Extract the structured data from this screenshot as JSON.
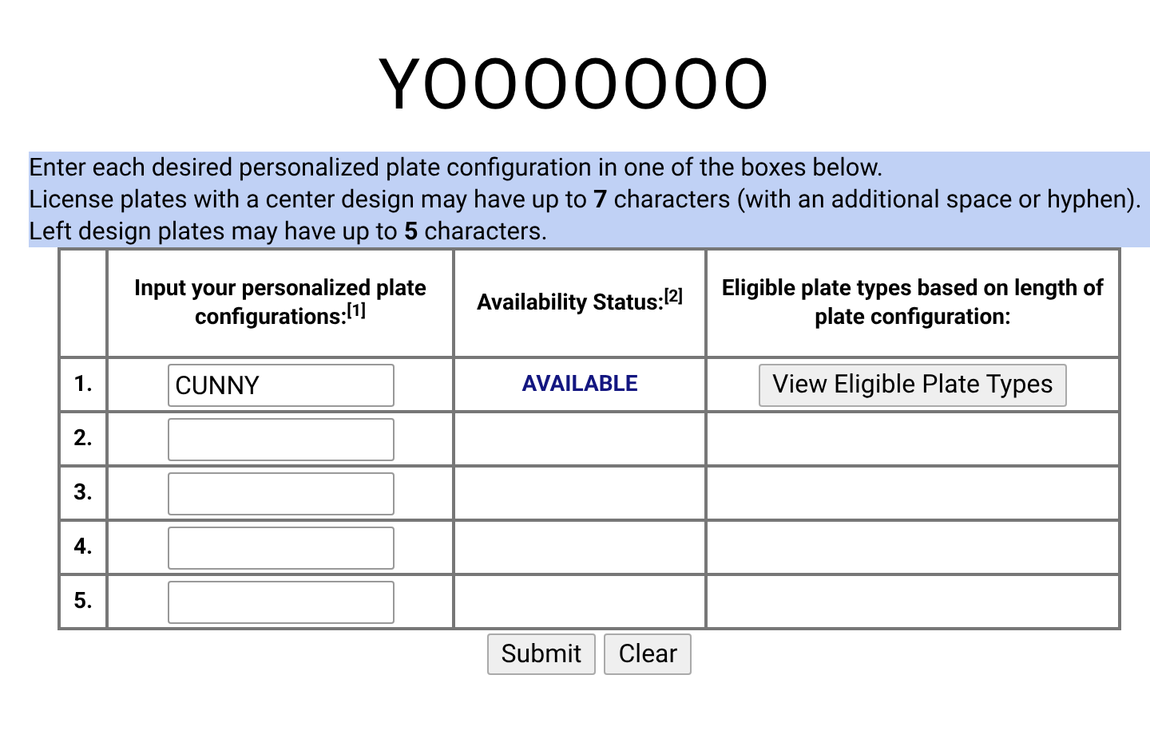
{
  "heading": "YOOOOOOO",
  "instructions": {
    "selected": true,
    "lines": [
      "Enter each desired personalized plate configuration in one of the boxes below.",
      "License plates with a center design may have up to **7** characters (with an additional space or hyphen). Left design plates may have up to **5** characters."
    ]
  },
  "table": {
    "columns": [
      "Input your personalized plate configurations:$^{[1]}$",
      "Availability Status:$^{[2]}$",
      "Eligible plate types based on length of plate configuration:"
    ],
    "rows": [
      {
        "number": "1.",
        "value": "CUNNY",
        "status": "AVAILABLE",
        "action": "View Eligible Plate Types"
      },
      {
        "number": "2."
      },
      {
        "number": "3."
      },
      {
        "number": "4."
      },
      {
        "number": "5."
      }
    ]
  },
  "buttons": [
    "Submit",
    "Clear"
  ]
}
